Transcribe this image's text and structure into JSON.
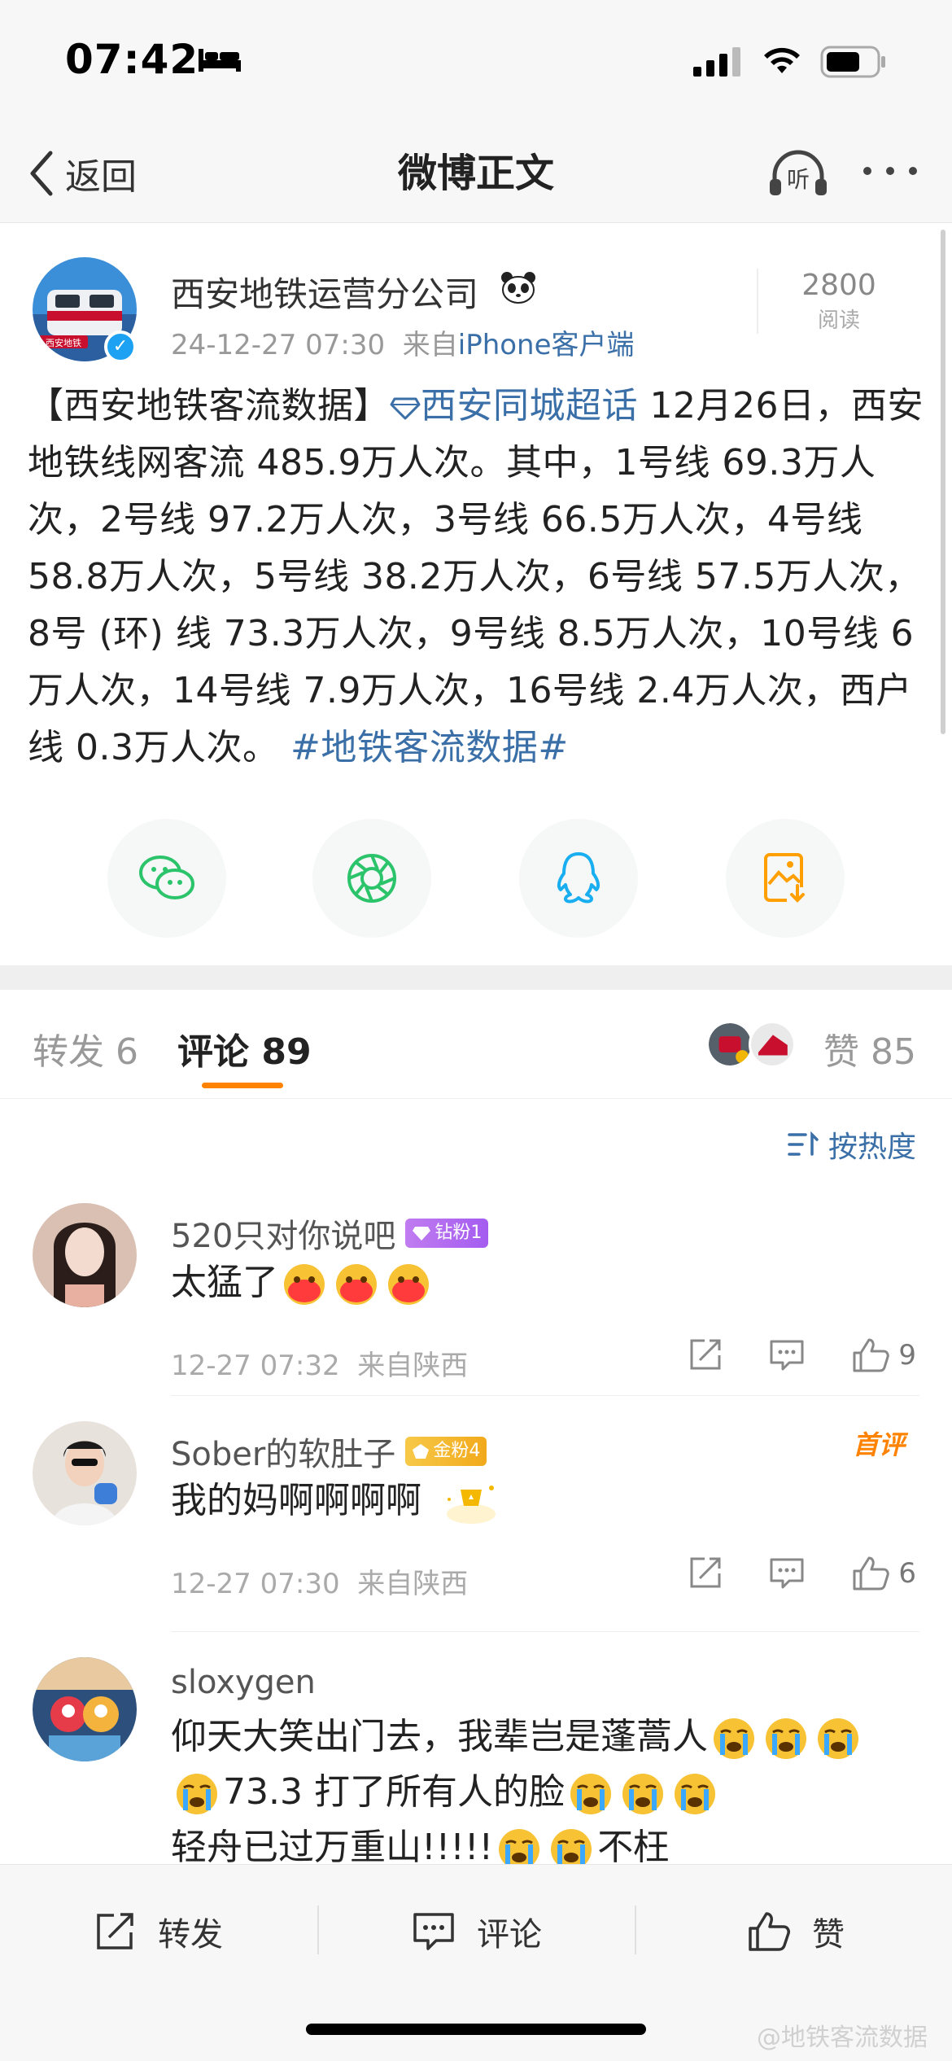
{
  "status": {
    "time": "07:42"
  },
  "nav": {
    "back_label": "返回",
    "title": "微博正文",
    "listen_label": "听"
  },
  "post": {
    "author": "西安地铁运营分公司",
    "avatar_text": "西安地铁",
    "date": "24-12-27 07:30",
    "source_prefix": "来自",
    "source": "iPhone客户端",
    "read_count": "2800",
    "read_label": "阅读",
    "body_bracket": "【西安地铁客流数据】",
    "topic_link": "西安同城超话",
    "body_text": " 12月26日，西安地铁线网客流 485.9万人次。其中，1号线 69.3万人次，2号线 97.2万人次，3号线 66.5万人次，4号线 58.8万人次，5号线 38.2万人次，6号线 57.5万人次，8号 (环) 线 73.3万人次，9号线 8.5万人次，10号线 6万人次，14号线 7.9万人次，16号线 2.4万人次，西户线 0.3万人次。",
    "hashtag": "#地铁客流数据#"
  },
  "share": [
    {
      "icon": "wechat-icon",
      "color": "#2bc46a"
    },
    {
      "icon": "moments-icon",
      "color": "#2bc46a"
    },
    {
      "icon": "qq-icon",
      "color": "#18aef0"
    },
    {
      "icon": "save-image-icon",
      "color": "#ff9f00"
    }
  ],
  "tabs": {
    "repost_label": "转发",
    "repost_count": "6",
    "comment_label": "评论",
    "comment_count": "89",
    "like_label": "赞",
    "like_count": "85"
  },
  "sort_label": "按热度",
  "comments": [
    {
      "name": "520只对你说吧",
      "badge": "钻粉1",
      "text": "太猛了",
      "time": "12-27 07:32",
      "loc": "来自陕西",
      "likes": "9"
    },
    {
      "name": "Sober的软肚子",
      "badge": "金粉4",
      "text": "我的妈啊啊啊啊",
      "first_label": "首评",
      "time": "12-27 07:30",
      "loc": "来自陕西",
      "likes": "6"
    },
    {
      "name": "sloxygen",
      "line1": "仰天大笑出门去，我辈岂是蓬蒿人",
      "line2": "73.3 打了所有人的脸",
      "line3": "轻舟已过万重山!!!!!",
      "line3_tail": "不枉"
    }
  ],
  "bottom": {
    "repost": "转发",
    "comment": "评论",
    "like": "赞"
  },
  "watermark": "@地铁客流数据"
}
